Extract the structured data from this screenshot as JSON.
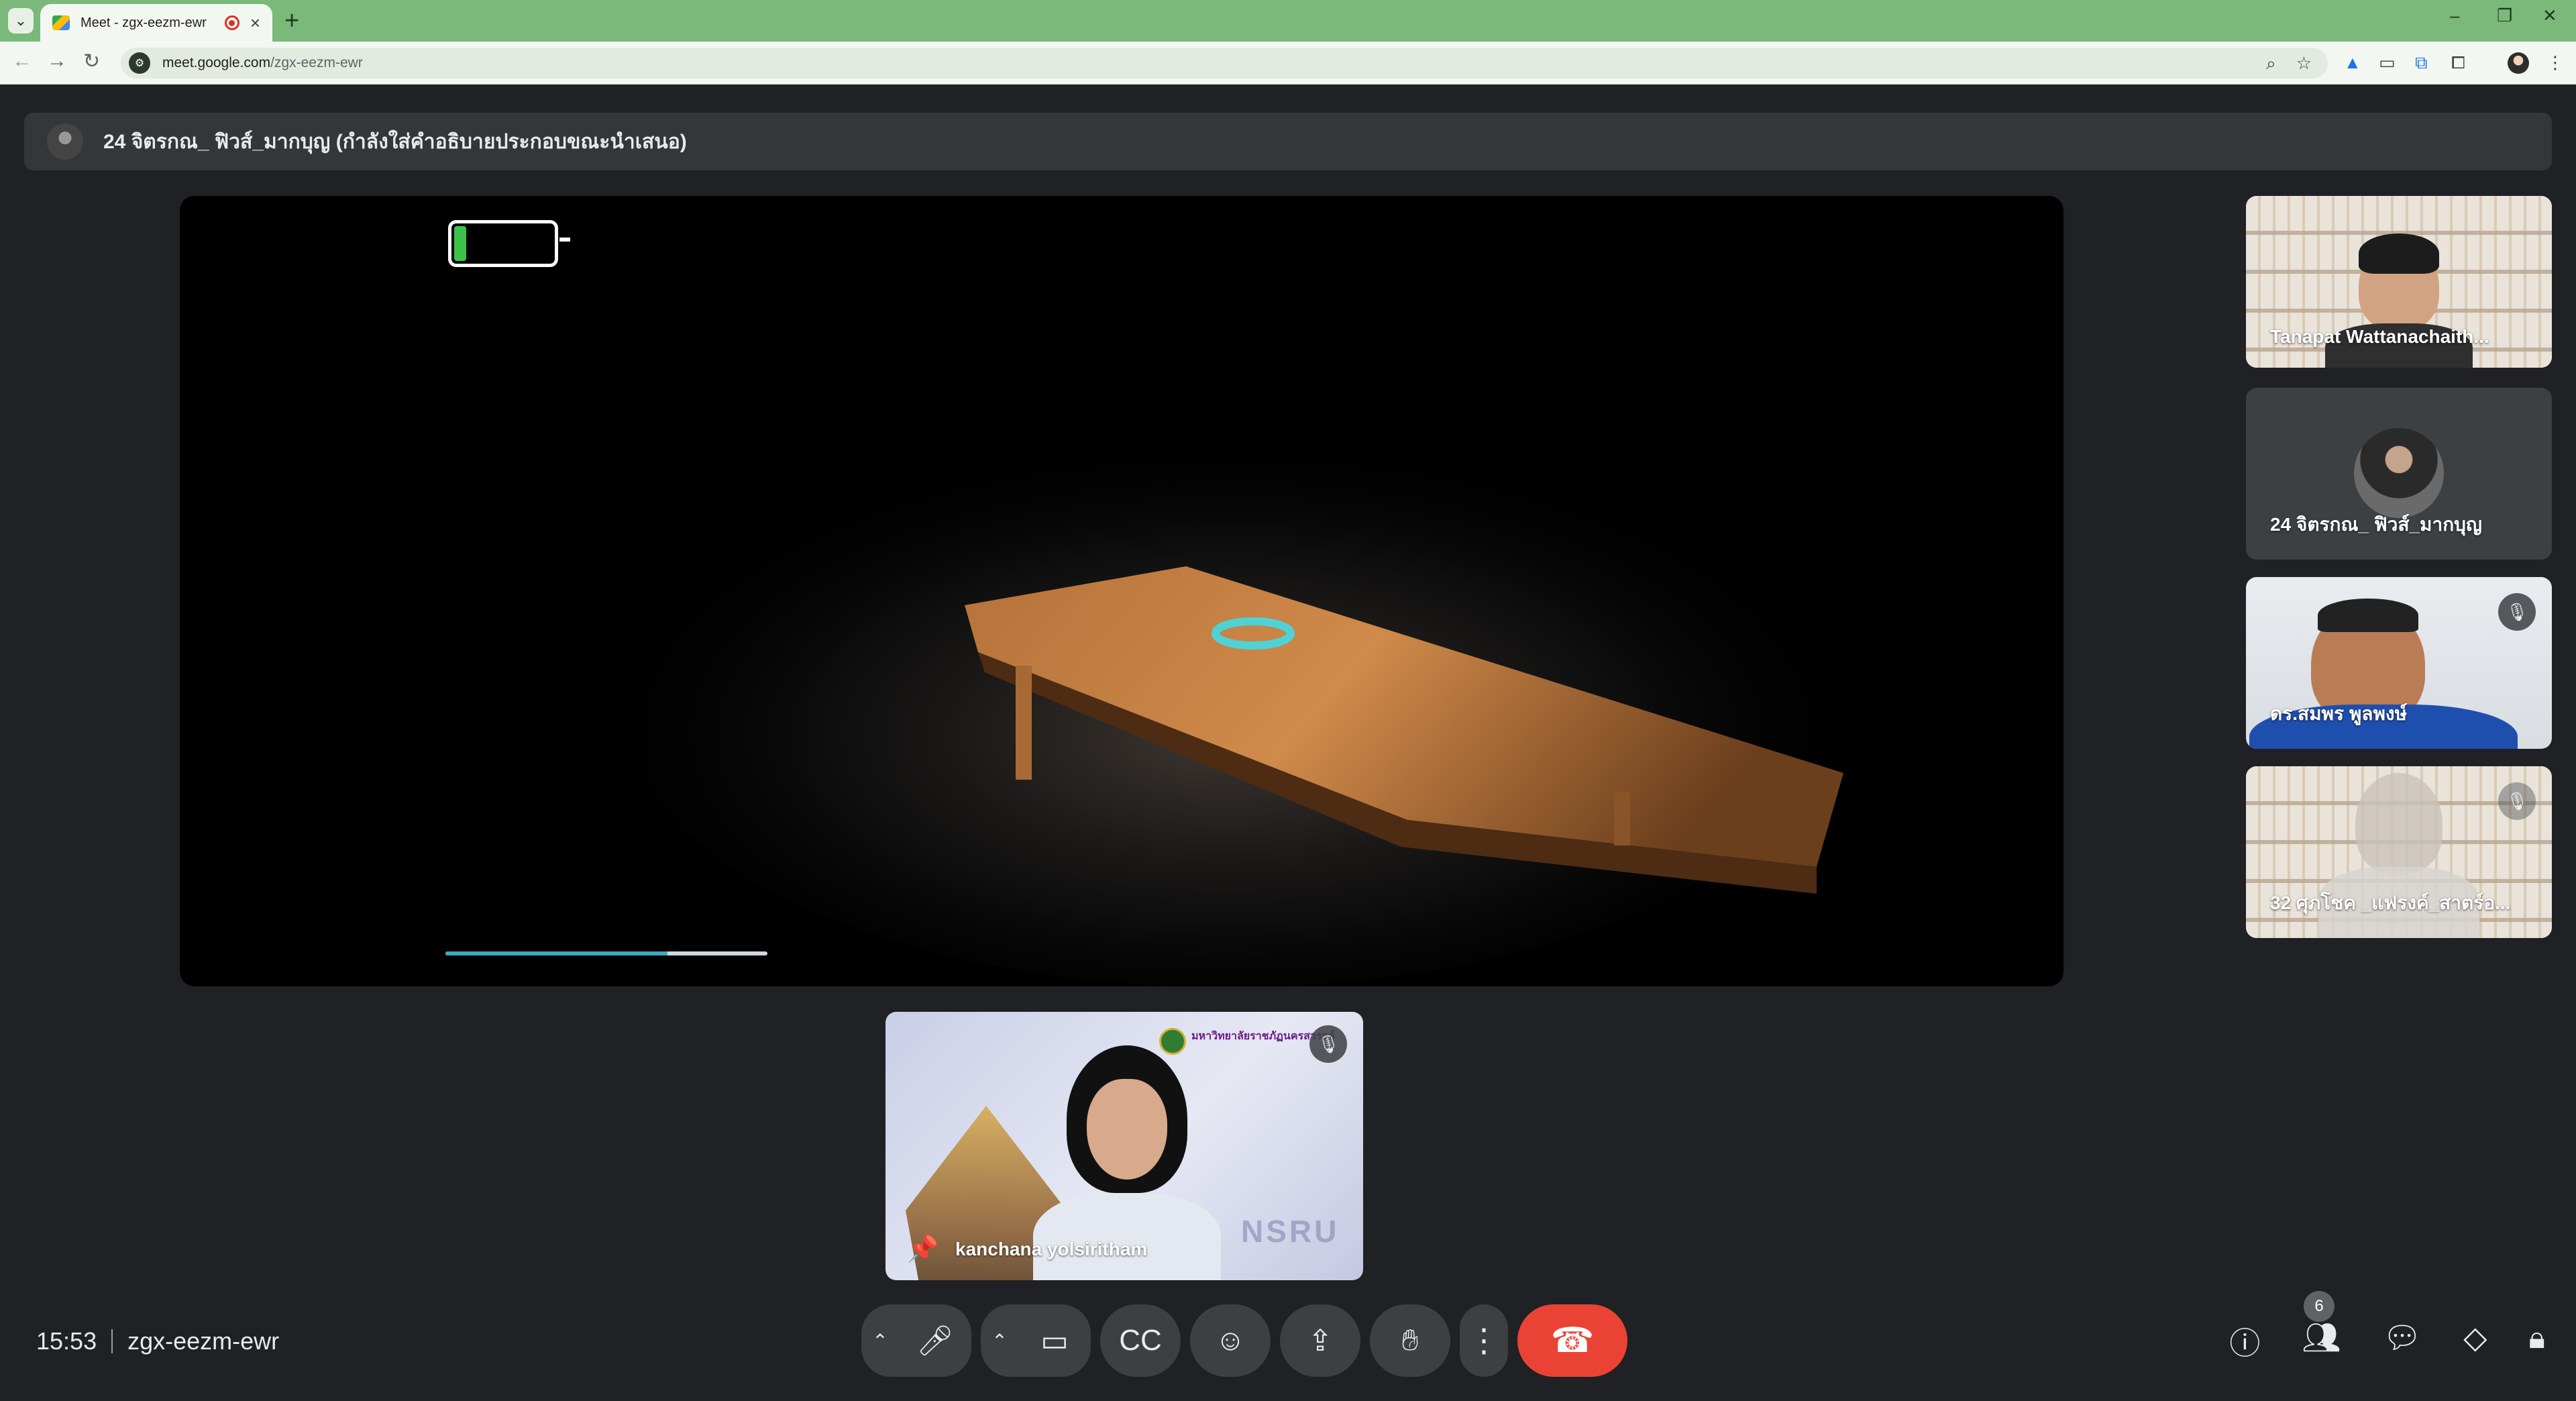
{
  "browser": {
    "tab_title": "Meet - zgx-eezm-ewr",
    "url_host": "meet.google.com",
    "url_path": "/zgx-eezm-ewr",
    "new_tab_glyph": "+",
    "tab_close_glyph": "×",
    "window_controls": [
      "–",
      "❐",
      "✕"
    ]
  },
  "presenter": {
    "label": "24 จิตรกณ_ ฟิวส์_มากบุญ (กำลังใส่คำอธิบายประกอบขณะนำเสนอ)"
  },
  "stage": {
    "progress": 0.69,
    "battery_level": "low"
  },
  "participants": [
    {
      "name": "Tanapat Wattanachaith...",
      "muted": false
    },
    {
      "name": "24 จิตรกณ_ ฟิวส์_มากบุญ",
      "muted": false
    },
    {
      "name": "ดร.สมพร พูลพงษ์",
      "muted": true
    },
    {
      "name": "32 ศุภโชค _แฟรงค์_สาตร์อ...",
      "muted": true
    }
  ],
  "pinned": {
    "name": "kanchana yolsiritham",
    "brand_text": "NSRU",
    "logo_text": "มหาวิทยาลัยราชภัฏนครสวรรค์"
  },
  "footer": {
    "time": "15:53",
    "meeting_code": "zgx-eezm-ewr",
    "people_count": "6"
  },
  "colors": {
    "end_call": "#ea4335",
    "tab_bar": "#7ab979",
    "progress": "#3aa9c4"
  }
}
